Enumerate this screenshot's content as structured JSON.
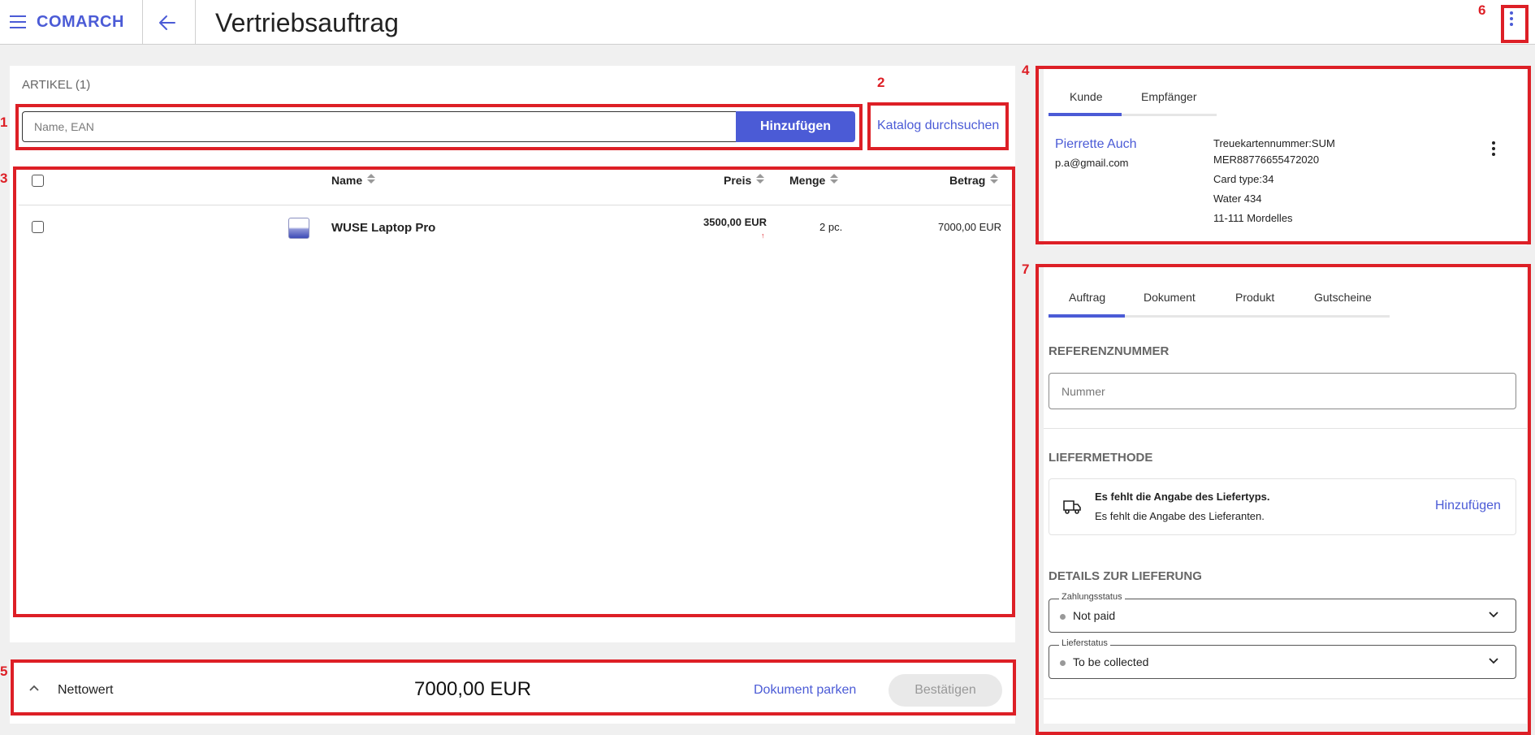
{
  "header": {
    "logo": "COMARCH",
    "title": "Vertriebsauftrag"
  },
  "annotations": {
    "n1": "1",
    "n2": "2",
    "n3": "3",
    "n4": "4",
    "n5": "5",
    "n6": "6",
    "n7": "7"
  },
  "articles": {
    "heading": "ARTIKEL (1)",
    "search_placeholder": "Name, EAN",
    "add_button": "Hinzufügen",
    "catalog_link": "Katalog durchsuchen",
    "columns": {
      "name": "Name",
      "price": "Preis",
      "quantity": "Menge",
      "amount": "Betrag"
    },
    "rows": [
      {
        "name": "WUSE Laptop Pro",
        "price": "3500,00 EUR",
        "price_marker": "↑",
        "quantity": "2 pc.",
        "amount": "7000,00 EUR"
      }
    ]
  },
  "customer": {
    "tabs": [
      "Kunde",
      "Empfänger"
    ],
    "active_tab": "Kunde",
    "name": "Pierrette Auch",
    "email": "p.a@gmail.com",
    "loyalty_line1": "Treuekartennummer:SUM",
    "loyalty_line2": "MER88776655472020",
    "card_type": "Card type:34",
    "street": "Water 434",
    "city": "11-111 Mordelles"
  },
  "order": {
    "tabs": [
      "Auftrag",
      "Dokument",
      "Produkt",
      "Gutscheine"
    ],
    "active_tab": "Auftrag",
    "reference_heading": "REFERENZNUMMER",
    "reference_placeholder": "Nummer",
    "delivery_heading": "LIEFERMETHODE",
    "delivery_missing_type": "Es fehlt die Angabe des Liefertyps.",
    "delivery_missing_supplier": "Es fehlt die Angabe des Lieferanten.",
    "delivery_add": "Hinzufügen",
    "details_heading": "DETAILS ZUR LIEFERUNG",
    "payment_label": "Zahlungsstatus",
    "payment_value": "Not paid",
    "shipping_label": "Lieferstatus",
    "shipping_value": "To be collected"
  },
  "footer": {
    "net_label": "Nettowert",
    "net_value": "7000,00 EUR",
    "park_link": "Dokument parken",
    "confirm_button": "Bestätigen"
  },
  "colors": {
    "accent": "#4b5bd6",
    "annotation": "#dd1f26"
  },
  "icons": [
    "menu-icon",
    "back-arrow-icon",
    "more-vert-icon",
    "sort-icon",
    "truck-icon",
    "chevron-down-icon",
    "chevron-up-icon"
  ]
}
